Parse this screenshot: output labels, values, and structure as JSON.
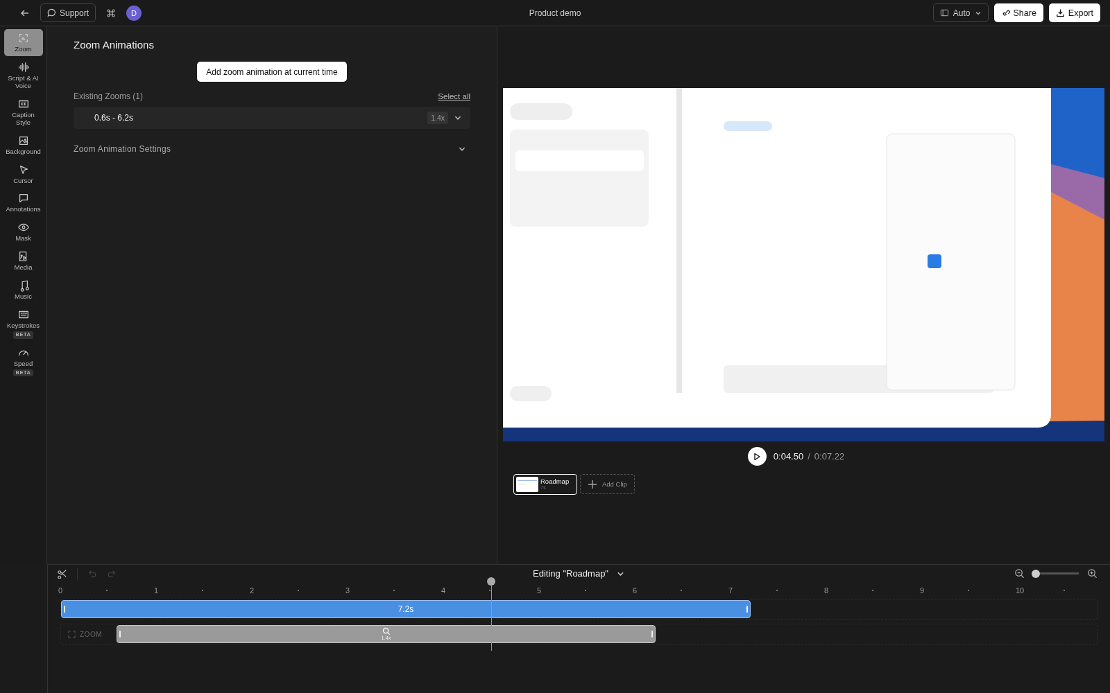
{
  "top_bar": {
    "support": "Support",
    "avatar": "D",
    "title": "Product demo",
    "aspect": "Auto",
    "share": "Share",
    "export": "Export"
  },
  "sidebar": {
    "items": [
      {
        "label": "Zoom",
        "selected": true
      },
      {
        "label": "Script & AI Voice",
        "selected": false
      },
      {
        "label": "Caption Style",
        "selected": false
      },
      {
        "label": "Background",
        "selected": false
      },
      {
        "label": "Cursor",
        "selected": false
      },
      {
        "label": "Annotations",
        "selected": false
      },
      {
        "label": "Mask",
        "selected": false
      },
      {
        "label": "Media",
        "selected": false
      },
      {
        "label": "Music",
        "selected": false
      },
      {
        "label": "Keystrokes",
        "badge": "BETA",
        "selected": false
      },
      {
        "label": "Speed",
        "badge": "BETA",
        "selected": false
      }
    ]
  },
  "panel": {
    "title": "Zoom Animations",
    "add_button": "Add zoom animation at current time",
    "existing_label": "Existing Zooms (1)",
    "select_all": "Select all",
    "zooms": [
      {
        "range": "0.6s - 6.2s",
        "scale": "1.4x",
        "expanded": false
      }
    ],
    "settings": {
      "label": "Zoom Animation Settings",
      "expanded": false
    }
  },
  "player": {
    "current": "0:04.50",
    "separator": "/",
    "total": "0:07.22"
  },
  "clips": [
    {
      "name": "Roadmap",
      "duration": "7s",
      "selected": true
    }
  ],
  "add_clip": "Add Clip",
  "timeline": {
    "title": "Editing \"Roadmap\"",
    "zoom_slider": {
      "level": 0.05
    },
    "ruler": [
      "0",
      "1",
      "2",
      "3",
      "4",
      "5",
      "6",
      "7",
      "8",
      "9",
      "10"
    ],
    "video_clip": "7.2s",
    "zoom_track_label": "ZOOM",
    "zoom_segment": "1.4x"
  }
}
